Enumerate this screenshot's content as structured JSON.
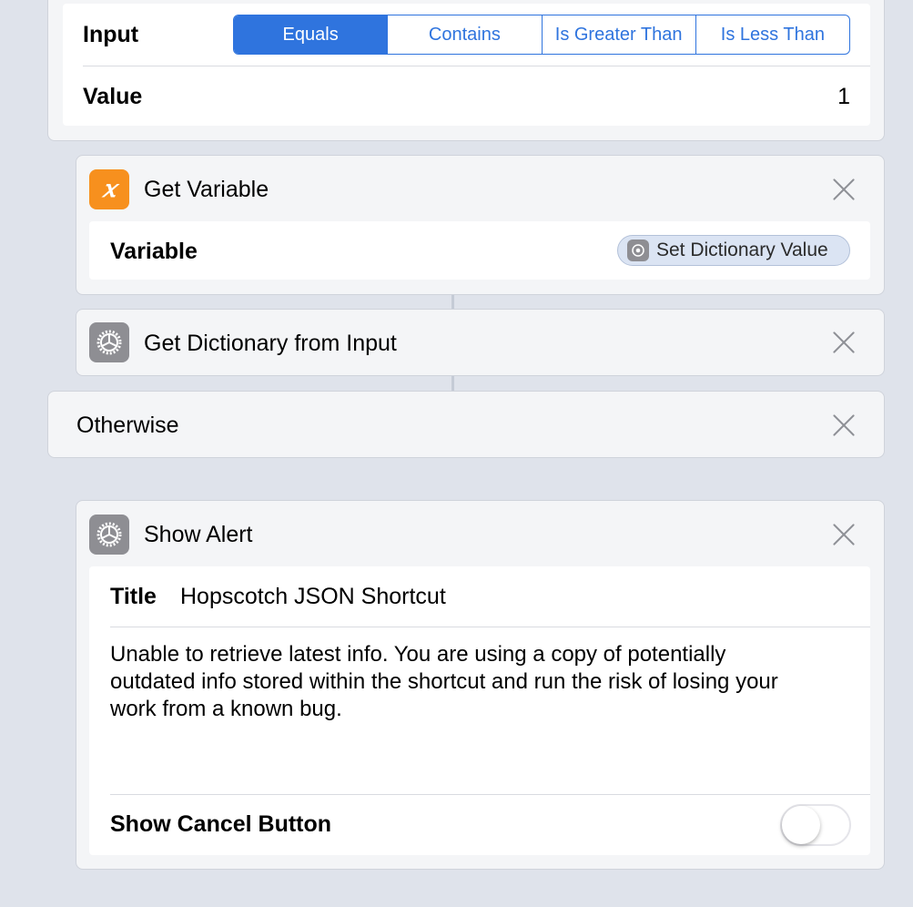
{
  "condition": {
    "input_label": "Input",
    "segments": [
      "Equals",
      "Contains",
      "Is Greater Than",
      "Is Less Than"
    ],
    "selected_segment": "Equals",
    "value_label": "Value",
    "value": "1"
  },
  "get_variable": {
    "title": "Get Variable",
    "icon_glyph": "𝑥",
    "variable_label": "Variable",
    "variable_value": "Set Dictionary Value"
  },
  "get_dictionary": {
    "title": "Get Dictionary from Input"
  },
  "otherwise": {
    "title": "Otherwise"
  },
  "show_alert": {
    "title": "Show Alert",
    "title_label": "Title",
    "title_value": "Hopscotch JSON Shortcut",
    "message": "Unable to retrieve latest info. You are using a copy of potentially outdated info stored within the shortcut and run the risk of losing your work from a known bug.",
    "cancel_label": "Show Cancel Button",
    "cancel_enabled": false
  },
  "colors": {
    "accent": "#2f74de",
    "variable_icon": "#f7901e",
    "gear_icon": "#8e8e93",
    "background": "#dfe3eb"
  }
}
